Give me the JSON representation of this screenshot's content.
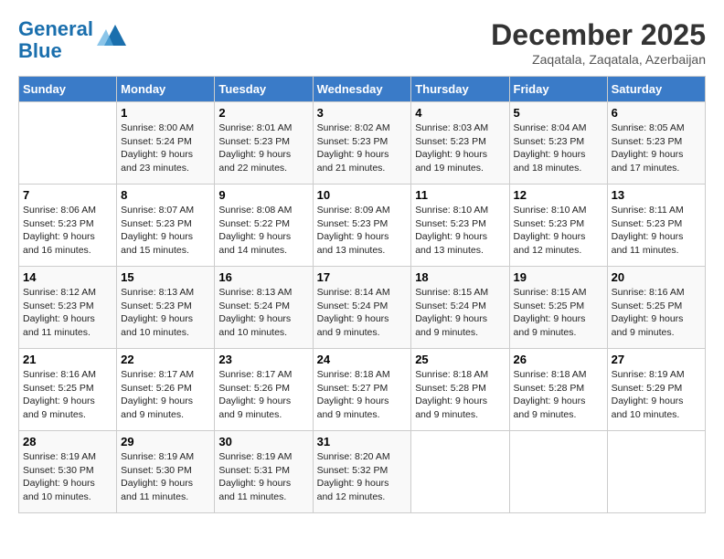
{
  "header": {
    "logo_line1": "General",
    "logo_line2": "Blue",
    "month": "December 2025",
    "location": "Zaqatala, Zaqatala, Azerbaijan"
  },
  "weekdays": [
    "Sunday",
    "Monday",
    "Tuesday",
    "Wednesday",
    "Thursday",
    "Friday",
    "Saturday"
  ],
  "weeks": [
    [
      {
        "day": "",
        "info": ""
      },
      {
        "day": "1",
        "info": "Sunrise: 8:00 AM\nSunset: 5:24 PM\nDaylight: 9 hours\nand 23 minutes."
      },
      {
        "day": "2",
        "info": "Sunrise: 8:01 AM\nSunset: 5:23 PM\nDaylight: 9 hours\nand 22 minutes."
      },
      {
        "day": "3",
        "info": "Sunrise: 8:02 AM\nSunset: 5:23 PM\nDaylight: 9 hours\nand 21 minutes."
      },
      {
        "day": "4",
        "info": "Sunrise: 8:03 AM\nSunset: 5:23 PM\nDaylight: 9 hours\nand 19 minutes."
      },
      {
        "day": "5",
        "info": "Sunrise: 8:04 AM\nSunset: 5:23 PM\nDaylight: 9 hours\nand 18 minutes."
      },
      {
        "day": "6",
        "info": "Sunrise: 8:05 AM\nSunset: 5:23 PM\nDaylight: 9 hours\nand 17 minutes."
      }
    ],
    [
      {
        "day": "7",
        "info": "Sunrise: 8:06 AM\nSunset: 5:23 PM\nDaylight: 9 hours\nand 16 minutes."
      },
      {
        "day": "8",
        "info": "Sunrise: 8:07 AM\nSunset: 5:23 PM\nDaylight: 9 hours\nand 15 minutes."
      },
      {
        "day": "9",
        "info": "Sunrise: 8:08 AM\nSunset: 5:22 PM\nDaylight: 9 hours\nand 14 minutes."
      },
      {
        "day": "10",
        "info": "Sunrise: 8:09 AM\nSunset: 5:23 PM\nDaylight: 9 hours\nand 13 minutes."
      },
      {
        "day": "11",
        "info": "Sunrise: 8:10 AM\nSunset: 5:23 PM\nDaylight: 9 hours\nand 13 minutes."
      },
      {
        "day": "12",
        "info": "Sunrise: 8:10 AM\nSunset: 5:23 PM\nDaylight: 9 hours\nand 12 minutes."
      },
      {
        "day": "13",
        "info": "Sunrise: 8:11 AM\nSunset: 5:23 PM\nDaylight: 9 hours\nand 11 minutes."
      }
    ],
    [
      {
        "day": "14",
        "info": "Sunrise: 8:12 AM\nSunset: 5:23 PM\nDaylight: 9 hours\nand 11 minutes."
      },
      {
        "day": "15",
        "info": "Sunrise: 8:13 AM\nSunset: 5:23 PM\nDaylight: 9 hours\nand 10 minutes."
      },
      {
        "day": "16",
        "info": "Sunrise: 8:13 AM\nSunset: 5:24 PM\nDaylight: 9 hours\nand 10 minutes."
      },
      {
        "day": "17",
        "info": "Sunrise: 8:14 AM\nSunset: 5:24 PM\nDaylight: 9 hours\nand 9 minutes."
      },
      {
        "day": "18",
        "info": "Sunrise: 8:15 AM\nSunset: 5:24 PM\nDaylight: 9 hours\nand 9 minutes."
      },
      {
        "day": "19",
        "info": "Sunrise: 8:15 AM\nSunset: 5:25 PM\nDaylight: 9 hours\nand 9 minutes."
      },
      {
        "day": "20",
        "info": "Sunrise: 8:16 AM\nSunset: 5:25 PM\nDaylight: 9 hours\nand 9 minutes."
      }
    ],
    [
      {
        "day": "21",
        "info": "Sunrise: 8:16 AM\nSunset: 5:25 PM\nDaylight: 9 hours\nand 9 minutes."
      },
      {
        "day": "22",
        "info": "Sunrise: 8:17 AM\nSunset: 5:26 PM\nDaylight: 9 hours\nand 9 minutes."
      },
      {
        "day": "23",
        "info": "Sunrise: 8:17 AM\nSunset: 5:26 PM\nDaylight: 9 hours\nand 9 minutes."
      },
      {
        "day": "24",
        "info": "Sunrise: 8:18 AM\nSunset: 5:27 PM\nDaylight: 9 hours\nand 9 minutes."
      },
      {
        "day": "25",
        "info": "Sunrise: 8:18 AM\nSunset: 5:28 PM\nDaylight: 9 hours\nand 9 minutes."
      },
      {
        "day": "26",
        "info": "Sunrise: 8:18 AM\nSunset: 5:28 PM\nDaylight: 9 hours\nand 9 minutes."
      },
      {
        "day": "27",
        "info": "Sunrise: 8:19 AM\nSunset: 5:29 PM\nDaylight: 9 hours\nand 10 minutes."
      }
    ],
    [
      {
        "day": "28",
        "info": "Sunrise: 8:19 AM\nSunset: 5:30 PM\nDaylight: 9 hours\nand 10 minutes."
      },
      {
        "day": "29",
        "info": "Sunrise: 8:19 AM\nSunset: 5:30 PM\nDaylight: 9 hours\nand 11 minutes."
      },
      {
        "day": "30",
        "info": "Sunrise: 8:19 AM\nSunset: 5:31 PM\nDaylight: 9 hours\nand 11 minutes."
      },
      {
        "day": "31",
        "info": "Sunrise: 8:20 AM\nSunset: 5:32 PM\nDaylight: 9 hours\nand 12 minutes."
      },
      {
        "day": "",
        "info": ""
      },
      {
        "day": "",
        "info": ""
      },
      {
        "day": "",
        "info": ""
      }
    ]
  ]
}
